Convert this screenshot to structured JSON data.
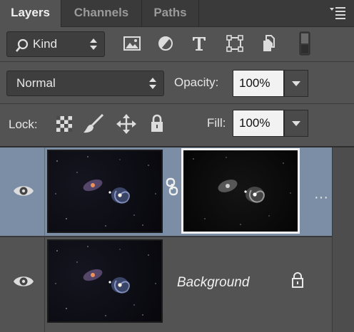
{
  "tabs": [
    {
      "label": "Layers",
      "active": true
    },
    {
      "label": "Channels",
      "active": false
    },
    {
      "label": "Paths",
      "active": false
    }
  ],
  "filter": {
    "kind_label": "Kind"
  },
  "filter_icons": [
    "image-filter-icon",
    "adjustment-filter-icon",
    "type-filter-icon",
    "shape-filter-icon",
    "smart-object-filter-icon",
    "filter-toggle-icon"
  ],
  "blend": {
    "mode": "Normal",
    "opacity_label": "Opacity:",
    "opacity_value": "100%"
  },
  "lock": {
    "label": "Lock:",
    "fill_label": "Fill:",
    "fill_value": "100%"
  },
  "layers": [
    {
      "name": "",
      "selected": true,
      "visible": true,
      "has_mask": true
    },
    {
      "name": "Background",
      "selected": false,
      "visible": true,
      "locked": true
    }
  ],
  "colors": {
    "panel_bg": "#535353",
    "tabbar_bg": "#3a3a3a",
    "selection": "#7b8ea6",
    "field_bg": "#3e3e3e"
  }
}
